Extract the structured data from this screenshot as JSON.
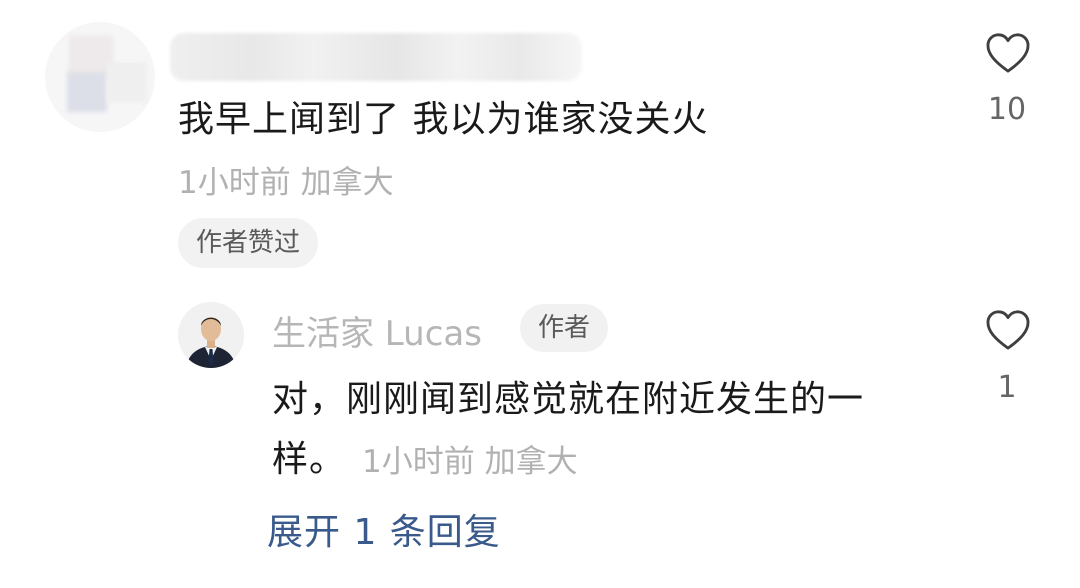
{
  "comment": {
    "text": "我早上闻到了 我以为谁家没关火",
    "time_location": "1小时前 加拿大",
    "author_liked_badge": "作者赞过",
    "like_count": "10"
  },
  "reply": {
    "username": "生活家 Lucas",
    "author_tag": "作者",
    "text_line1": "对，刚刚闻到感觉就在附近发生的一",
    "text_line2": "样。",
    "time_location": "1小时前 加拿大",
    "like_count": "1"
  },
  "expand_replies": "展开 1 条回复",
  "colors": {
    "link": "#3a5a8c",
    "meta_gray": "#b1b1b1",
    "badge_bg": "#f2f2f2"
  },
  "icons": {
    "like": "heart-outline-icon"
  }
}
